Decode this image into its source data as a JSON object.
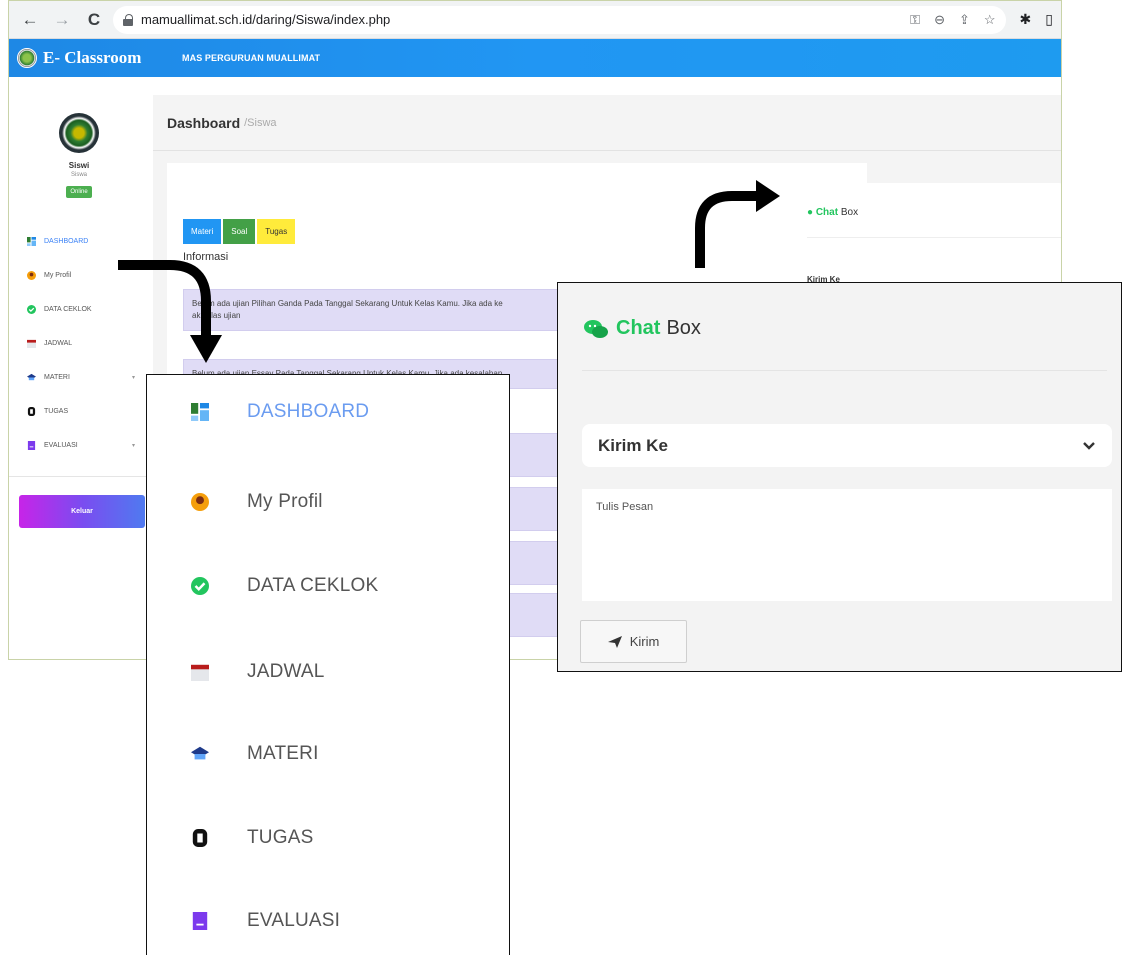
{
  "browser": {
    "url": "mamuallimat.sch.id/daring/Siswa/index.php",
    "back_icon": "←",
    "forward_icon": "→",
    "reload_icon": "C"
  },
  "app": {
    "brand": "E- Classroom",
    "school": "MAS PERGURUAN MUALLIMAT"
  },
  "profile": {
    "name": "Siswi",
    "role": "Siswa",
    "status": "Online"
  },
  "sidebar": {
    "items": [
      {
        "label": "DASHBOARD",
        "active": true
      },
      {
        "label": "My Profil"
      },
      {
        "label": "DATA CEKLOK"
      },
      {
        "label": "JADWAL"
      },
      {
        "label": "MATERI",
        "has_caret": true
      },
      {
        "label": "TUGAS"
      },
      {
        "label": "EVALUASI",
        "has_caret": true
      }
    ],
    "logout": "Keluar"
  },
  "page": {
    "title": "Dashboard",
    "crumb": "/Siswa",
    "tabs": [
      "Materi",
      "Soal",
      "Tugas"
    ],
    "section": "Informasi",
    "notices": [
      "Belum ada ujian Pilihan Ganda Pada Tanggal Sekarang Untuk Kelas Kamu. Jika ada ke",
      "ak kelas ujian",
      "Belum ada ujian Essay Pada Tanggal Sekarang Untuk Kelas Kamu. Jika ada kesalahan"
    ]
  },
  "chat_mini": {
    "title_bold": "Chat",
    "title_rest": "Box",
    "field": "Kirim Ke"
  },
  "zoom_menu": {
    "items": [
      "DASHBOARD",
      "My Profil",
      "DATA CEKLOK",
      "JADWAL",
      "MATERI",
      "TUGAS",
      "EVALUASI"
    ]
  },
  "zoom_chat": {
    "title_bold": "Chat",
    "title_rest": "Box",
    "select_value": "Kirim Ke",
    "textarea_placeholder": "Tulis Pesan",
    "send_label": "Kirim"
  },
  "colors": {
    "header": "#2196f3",
    "chat_green": "#22c55e",
    "active_menu": "#3b82f6",
    "notice_bg": "#e0dcf6",
    "tab_materi": "#2196f3",
    "tab_soal": "#43a047",
    "tab_tugas": "#ffeb3b"
  }
}
